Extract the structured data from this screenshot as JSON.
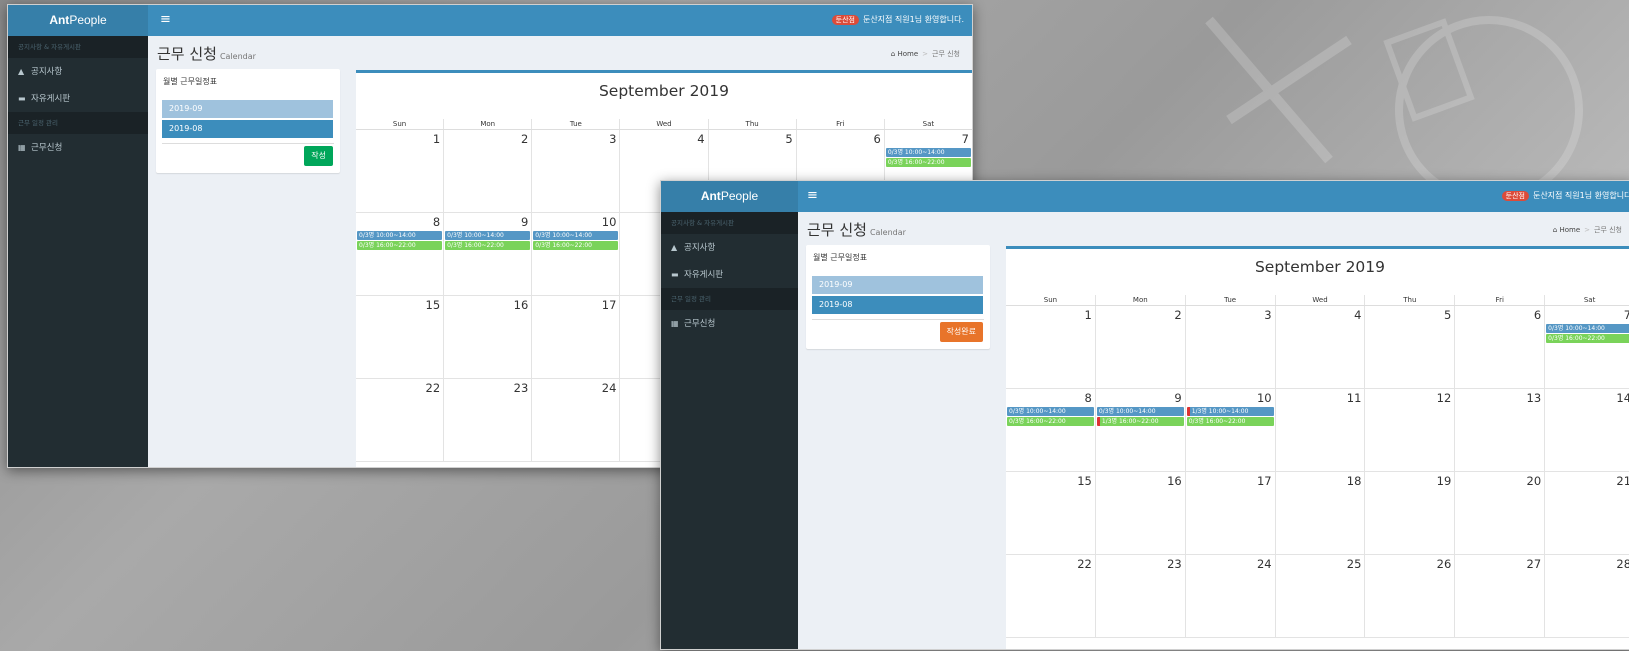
{
  "app": {
    "logo_bold": "Ant",
    "logo_rest": "People",
    "store_badge": "둔산점",
    "welcome_text": "둔산지점 직원1님 환영합니다."
  },
  "sidebar": {
    "section1": "공지사항 & 자유게시판",
    "item_notice": "공지사항",
    "item_board": "자유게시판",
    "section2": "근무 일정 관리",
    "item_request": "근무신청"
  },
  "page": {
    "title": "근무 신청",
    "subtitle": "Calendar",
    "breadcrumb_home": "Home",
    "breadcrumb_current": "근무 신청"
  },
  "schedule_panel": {
    "title": "월별 근무일정표",
    "months": [
      "2019-09",
      "2019-08"
    ],
    "button_window1": "작성",
    "button_window2": "작성완료"
  },
  "calendar": {
    "title": "September 2019",
    "weekdays": [
      "Sun",
      "Mon",
      "Tue",
      "Wed",
      "Thu",
      "Fri",
      "Sat"
    ],
    "weeks": [
      [
        "1",
        "2",
        "3",
        "4",
        "5",
        "6",
        "7"
      ],
      [
        "8",
        "9",
        "10",
        "11",
        "12",
        "13",
        "14"
      ],
      [
        "15",
        "16",
        "17",
        "18",
        "19",
        "20",
        "21"
      ],
      [
        "22",
        "23",
        "24",
        "25",
        "26",
        "27",
        "28"
      ]
    ],
    "events_window1": {
      "sat_7": [
        "0/3명  10:00~14:00",
        "0/3명  16:00~22:00"
      ],
      "sun_8": [
        "0/3명  10:00~14:00",
        "0/3명  16:00~22:00"
      ],
      "mon_9": [
        "0/3명  10:00~14:00",
        "0/3명  16:00~22:00"
      ],
      "tue_10": [
        "0/3명  10:00~14:00",
        "0/3명  16:00~22:00"
      ]
    },
    "events_window2": {
      "sat_7": [
        "0/3명  10:00~14:00",
        "0/3명  16:00~22:00"
      ],
      "sun_8": [
        "0/3명  10:00~14:00",
        "0/3명  16:00~22:00"
      ],
      "mon_9": [
        "0/3명  10:00~14:00",
        "1/3명  16:00~22:00"
      ],
      "tue_10": [
        "1/3명  10:00~14:00",
        "0/3명  16:00~22:00"
      ]
    }
  },
  "colors": {
    "header": "#3c8dbc",
    "logo_bg": "#367fa9",
    "sidebar": "#222d32",
    "event_blue": "#5597c5",
    "event_green": "#7ad35a",
    "btn_green": "#00a65a",
    "btn_orange": "#e8742a",
    "badge_red": "#dd4b39"
  }
}
